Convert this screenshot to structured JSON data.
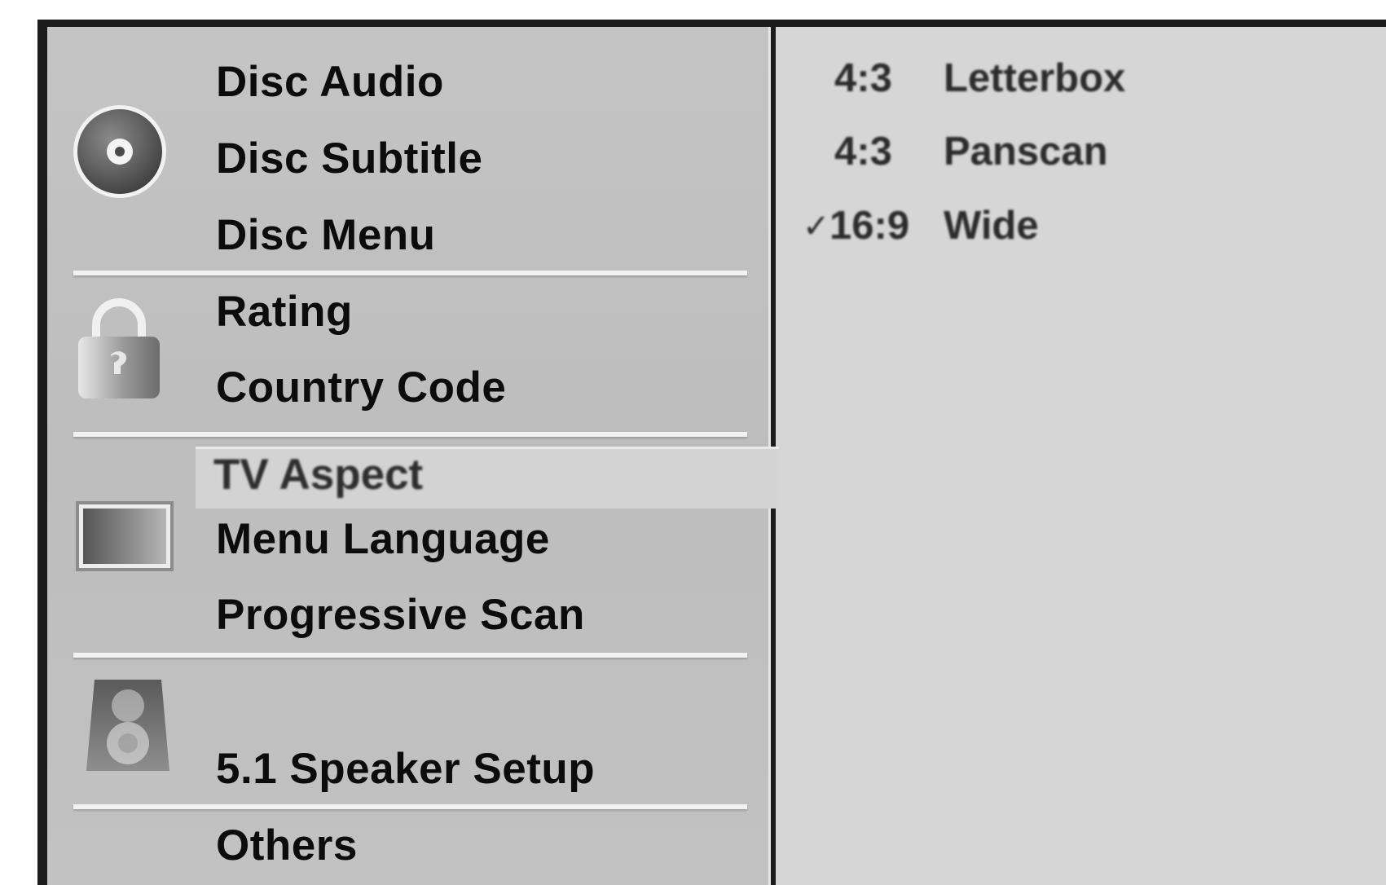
{
  "menu": {
    "items": [
      {
        "label": "Disc Audio"
      },
      {
        "label": "Disc Subtitle"
      },
      {
        "label": "Disc Menu"
      },
      {
        "label": "Rating"
      },
      {
        "label": "Country Code"
      },
      {
        "label": "TV Aspect"
      },
      {
        "label": "Menu Language"
      },
      {
        "label": "Progressive Scan"
      },
      {
        "label": "5.1 Speaker Setup"
      },
      {
        "label": "Others"
      }
    ],
    "selected": "TV Aspect"
  },
  "submenu": {
    "options": [
      {
        "ratio": "4:3",
        "name": "Letterbox",
        "checked": false
      },
      {
        "ratio": "4:3",
        "name": "Panscan",
        "checked": false
      },
      {
        "ratio": "16:9",
        "name": "Wide",
        "checked": true
      }
    ],
    "check_mark": "✓"
  },
  "icons": {
    "group1": "disc-icon",
    "group2": "padlock-icon",
    "group3": "tv-screen-icon",
    "group4": "speaker-icon"
  },
  "colors": {
    "left_panel": "#c1c1c1",
    "right_panel": "#d6d6d6",
    "text": "#0c0c0c",
    "frame": "#1c1c1c"
  }
}
